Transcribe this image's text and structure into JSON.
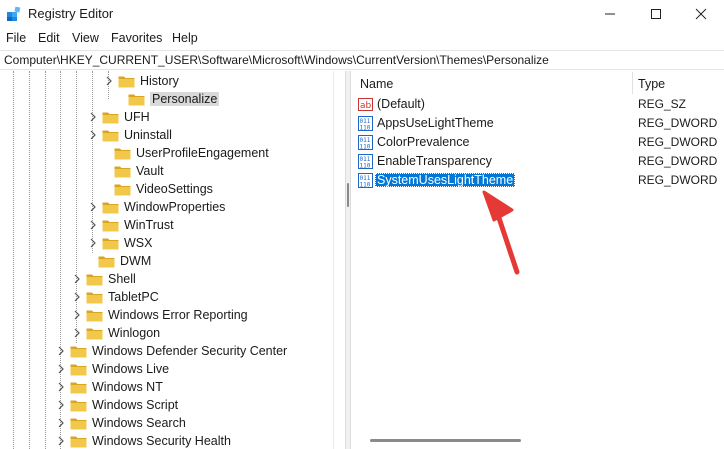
{
  "window": {
    "title": "Registry Editor"
  },
  "icons": {
    "app": "registry-icon",
    "minimize": "minimize-icon",
    "maximize": "maximize-icon",
    "close": "close-icon"
  },
  "menu": [
    "File",
    "Edit",
    "View",
    "Favorites",
    "Help"
  ],
  "address": "Computer\\HKEY_CURRENT_USER\\Software\\Microsoft\\Windows\\CurrentVersion\\Themes\\Personalize",
  "tree": [
    {
      "label": "History",
      "expandable": true,
      "selected": false
    },
    {
      "label": "Personalize",
      "expandable": false,
      "selected": true
    },
    {
      "label": "UFH",
      "expandable": true,
      "selected": false
    },
    {
      "label": "Uninstall",
      "expandable": true,
      "selected": false
    },
    {
      "label": "UserProfileEngagement",
      "expandable": false,
      "selected": false
    },
    {
      "label": "Vault",
      "expandable": false,
      "selected": false
    },
    {
      "label": "VideoSettings",
      "expandable": false,
      "selected": false
    },
    {
      "label": "WindowProperties",
      "expandable": true,
      "selected": false
    },
    {
      "label": "WinTrust",
      "expandable": true,
      "selected": false
    },
    {
      "label": "WSX",
      "expandable": true,
      "selected": false
    },
    {
      "label": "DWM",
      "expandable": false,
      "selected": false
    },
    {
      "label": "Shell",
      "expandable": true,
      "selected": false
    },
    {
      "label": "TabletPC",
      "expandable": true,
      "selected": false
    },
    {
      "label": "Windows Error Reporting",
      "expandable": true,
      "selected": false
    },
    {
      "label": "Winlogon",
      "expandable": true,
      "selected": false
    },
    {
      "label": "Windows Defender Security Center",
      "expandable": true,
      "selected": false
    },
    {
      "label": "Windows Live",
      "expandable": true,
      "selected": false
    },
    {
      "label": "Windows NT",
      "expandable": true,
      "selected": false
    },
    {
      "label": "Windows Script",
      "expandable": true,
      "selected": false
    },
    {
      "label": "Windows Search",
      "expandable": true,
      "selected": false
    },
    {
      "label": "Windows Security Health",
      "expandable": true,
      "selected": false
    }
  ],
  "columns": {
    "name": "Name",
    "type": "Type"
  },
  "values": [
    {
      "name": "(Default)",
      "type": "REG_SZ",
      "icon": "string-value-icon",
      "selected": false
    },
    {
      "name": "AppsUseLightTheme",
      "type": "REG_DWORD",
      "icon": "binary-value-icon",
      "selected": false
    },
    {
      "name": "ColorPrevalence",
      "type": "REG_DWORD",
      "icon": "binary-value-icon",
      "selected": false
    },
    {
      "name": "EnableTransparency",
      "type": "REG_DWORD",
      "icon": "binary-value-icon",
      "selected": false
    },
    {
      "name": "SystemUsesLightTheme",
      "type": "REG_DWORD",
      "icon": "binary-value-icon",
      "selected": true
    }
  ],
  "annotation": {
    "color": "#e53935",
    "icon": "arrow-pointer-icon"
  },
  "colors": {
    "selection": "#0078d7",
    "folder": "#f2c84b",
    "folder_dark": "#d9a520"
  }
}
